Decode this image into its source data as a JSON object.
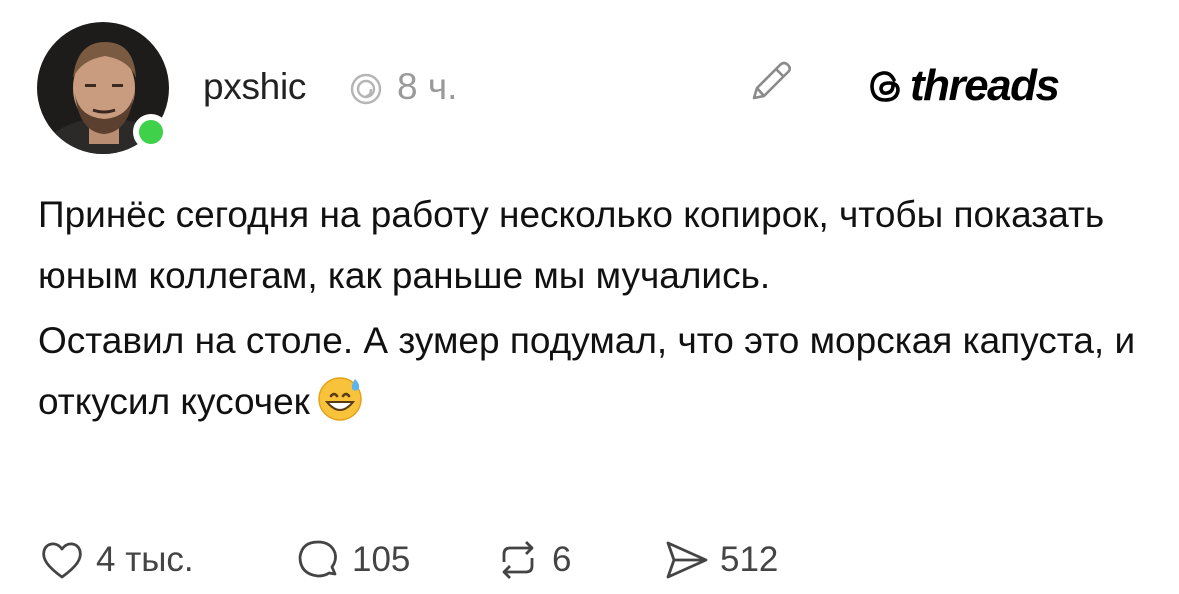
{
  "header": {
    "username": "pxshic",
    "timestamp": "8 ч.",
    "logo_text": "threads"
  },
  "post": {
    "paragraph1": "Принёс сегодня на работу несколько копирок, чтобы показать юным коллегам, как раньше мы мучались.",
    "paragraph2": "Оставил на столе. А зумер подумал, что это морская капуста, и откусил кусочек"
  },
  "actions": {
    "likes": "4 тыс.",
    "replies": "105",
    "reposts": "6",
    "shares": "512"
  },
  "colors": {
    "online": "#3fd14a",
    "muted": "#9a9a9a"
  }
}
